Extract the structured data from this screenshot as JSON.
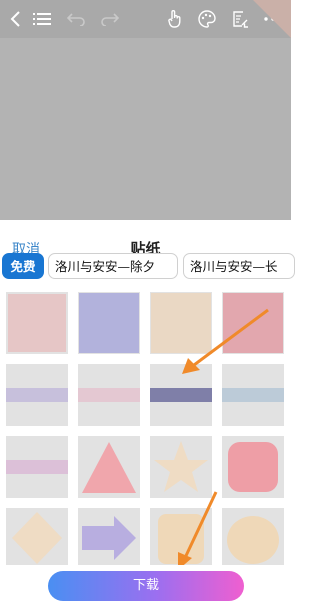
{
  "toolbar": {
    "icons": [
      "back-icon",
      "list-icon",
      "undo-icon",
      "redo-icon",
      "hand-pointer-icon",
      "palette-icon",
      "edit-document-icon",
      "more-icon"
    ]
  },
  "sticker_panel": {
    "cancel_label": "取消",
    "title": "贴纸",
    "tabs": [
      {
        "label": "免费",
        "active": true
      },
      {
        "label": "洛川与安安—除夕",
        "active": false
      },
      {
        "label": "洛川与安安—长",
        "active": false
      }
    ],
    "download_label": "下载"
  },
  "colors": {
    "toolbar": "#a9a9a9",
    "canvas": "#b3b3b3",
    "accent_blue": "#1976d2",
    "link_blue": "#3b86c9",
    "arrow_orange": "#f08a2a"
  }
}
